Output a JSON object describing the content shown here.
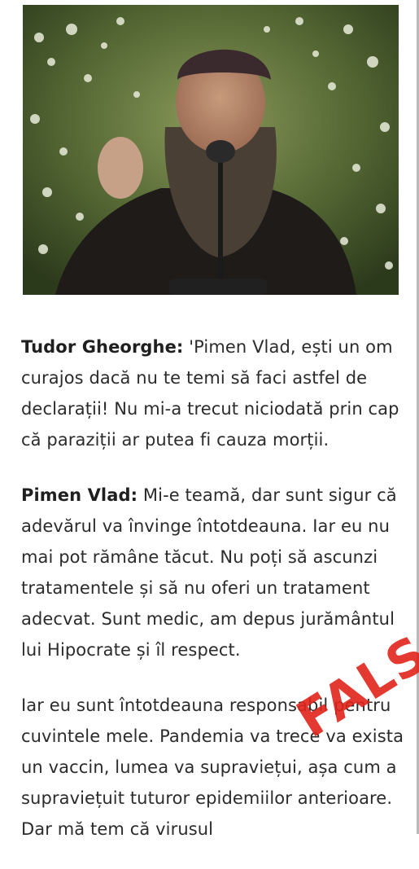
{
  "article": {
    "paragraphs": [
      {
        "speaker": "Tudor Gheorghe:",
        "text": " 'Pimen Vlad, ești un om curajos dacă nu te temi să faci astfel de declarații! Nu mi-a trecut niciodată prin cap că paraziții ar putea fi cauza morții."
      },
      {
        "speaker": "Pimen Vlad:",
        "text": " Mi-e teamă, dar sunt sigur că adevărul va învinge întotdeauna. Iar eu nu mai pot rămâne tăcut. Nu poți să ascunzi tratamentele și să nu oferi un tratament adecvat. Sunt medic, am depus jurământul lui Hipocrate și îl respect."
      },
      {
        "speaker": "",
        "text": "Iar eu sunt întotdeauna responsabil pentru cuvintele mele. Pandemia va trece va exista un vaccin, lumea va supraviețui, așa cum a supraviețuit tuturor epidemiilor anterioare. Dar mă tem că virusul"
      }
    ]
  },
  "stamp": {
    "label": "FALS",
    "color": "#e0241b"
  },
  "colors": {
    "text": "#2b2b2b",
    "rule": "#b9b9b9"
  }
}
